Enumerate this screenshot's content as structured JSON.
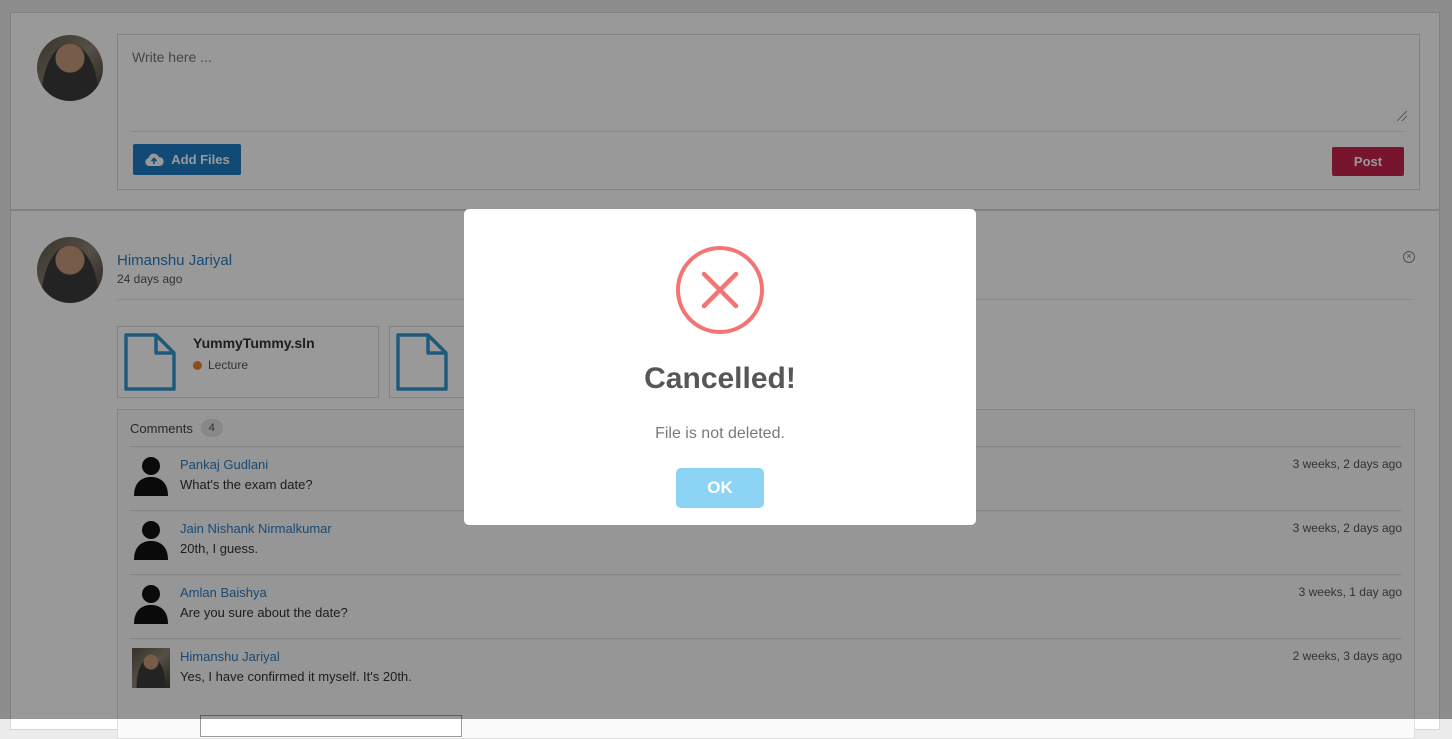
{
  "composer": {
    "placeholder": "Write here ...",
    "add_files_label": "Add Files",
    "post_label": "Post"
  },
  "post": {
    "author": "Himanshu Jariyal",
    "time": "24 days ago",
    "files": [
      {
        "name": "YummyTummy.sln",
        "tag": "Lecture",
        "tag_color": "#e8842a"
      },
      {
        "name": "",
        "tag": ""
      }
    ],
    "comments": {
      "label": "Comments",
      "count": "4",
      "items": [
        {
          "name": "Pankaj Gudlani",
          "text": "What's the exam date?",
          "time": "3 weeks, 2 days ago",
          "avatar": "person-silhouette"
        },
        {
          "name": "Jain Nishank Nirmalkumar",
          "text": "20th, I guess.",
          "time": "3 weeks, 2 days ago",
          "avatar": "person-silhouette"
        },
        {
          "name": "Amlan Baishya",
          "text": "Are you sure about the date?",
          "time": "3 weeks, 1 day ago",
          "avatar": "person-silhouette"
        },
        {
          "name": "Himanshu Jariyal",
          "text": "Yes, I have confirmed it myself. It's 20th.",
          "time": "2 weeks, 3 days ago",
          "avatar": "user-photo"
        }
      ]
    }
  },
  "modal": {
    "title": "Cancelled!",
    "message": "File is not deleted.",
    "ok_label": "OK",
    "icon": "error-x-icon",
    "icon_color": "#f27474",
    "button_color": "#8cd4f5"
  },
  "colors": {
    "add_files": "#1d7ec3",
    "post": "#c9244d",
    "link": "#2b7cc2"
  }
}
